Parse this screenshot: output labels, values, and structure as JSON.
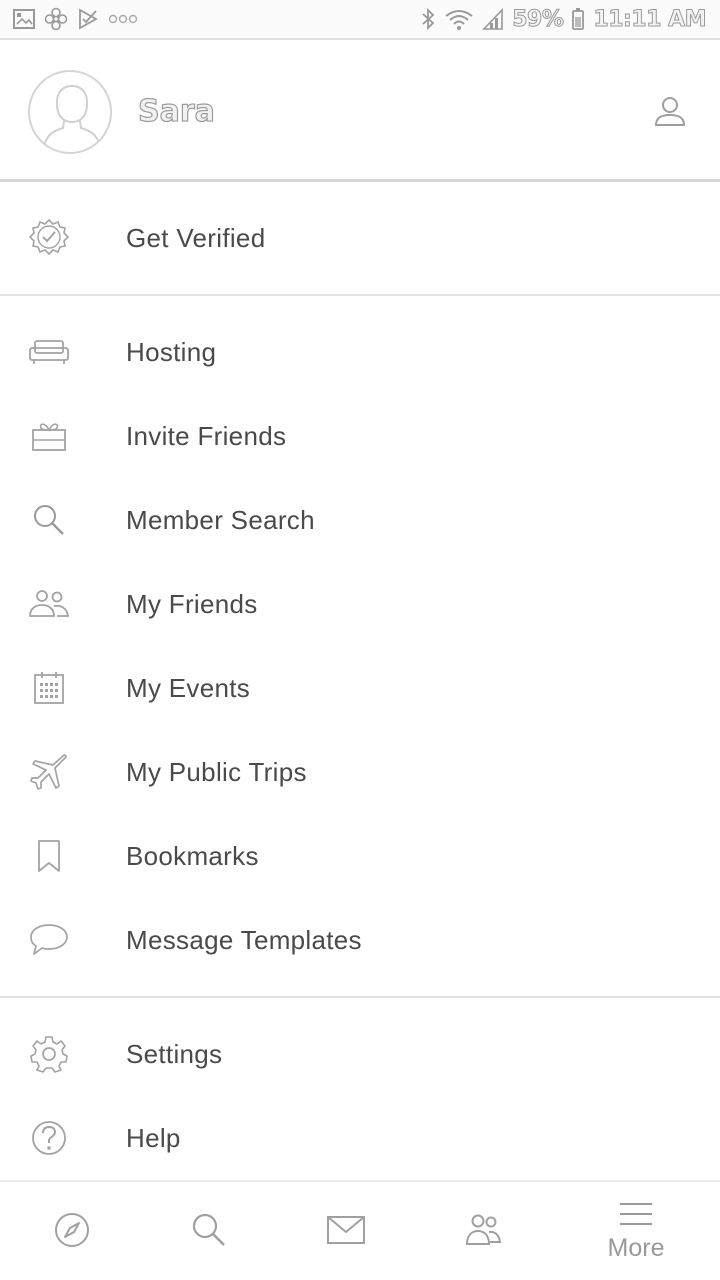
{
  "status_bar": {
    "battery": "59%",
    "time": "11:11 AM",
    "left_icons": [
      "gallery-icon",
      "pinwheel-icon",
      "checkbox-flag-icon",
      "more-dots-icon"
    ],
    "right_icons": [
      "bluetooth-icon",
      "wifi-icon",
      "signal-icon",
      "battery-icon"
    ]
  },
  "profile": {
    "name": "Sara",
    "avatar_icon": "default-avatar-icon",
    "profile_button_icon": "person-icon"
  },
  "menu": {
    "verify": {
      "label": "Get Verified",
      "icon": "verified-badge-icon"
    },
    "items": [
      {
        "label": "Hosting",
        "icon": "couch-icon"
      },
      {
        "label": "Invite Friends",
        "icon": "gift-icon"
      },
      {
        "label": "Member Search",
        "icon": "search-icon"
      },
      {
        "label": "My Friends",
        "icon": "people-icon"
      },
      {
        "label": "My Events",
        "icon": "calendar-icon"
      },
      {
        "label": "My Public Trips",
        "icon": "airplane-icon"
      },
      {
        "label": "Bookmarks",
        "icon": "bookmark-icon"
      },
      {
        "label": "Message Templates",
        "icon": "speech-bubble-icon"
      }
    ],
    "footer_items": [
      {
        "label": "Settings",
        "icon": "gear-icon"
      },
      {
        "label": "Help",
        "icon": "help-icon"
      }
    ]
  },
  "bottom_nav": {
    "items": [
      {
        "icon": "compass-icon",
        "label": ""
      },
      {
        "icon": "search-icon",
        "label": ""
      },
      {
        "icon": "mail-icon",
        "label": ""
      },
      {
        "icon": "people-icon",
        "label": ""
      },
      {
        "icon": "menu-icon",
        "label": "More"
      }
    ]
  },
  "colors": {
    "icon": "#9e9e9e",
    "text": "#4a4a4a",
    "divider": "#e2e2e2"
  }
}
